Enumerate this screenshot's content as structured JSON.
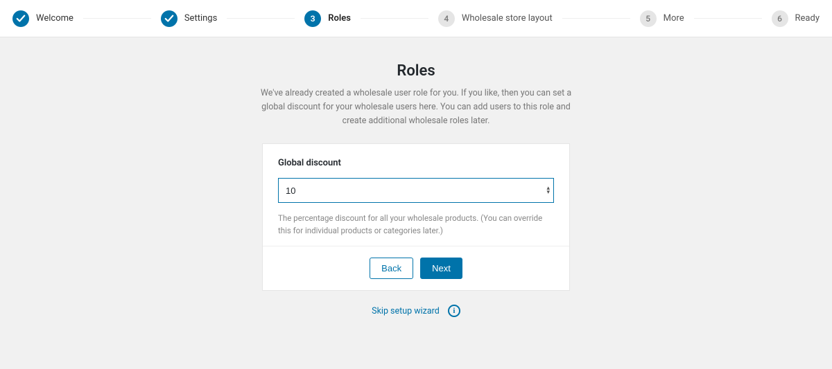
{
  "stepper": {
    "steps": [
      {
        "label": "Welcome",
        "state": "done",
        "number": "1"
      },
      {
        "label": "Settings",
        "state": "done",
        "number": "2"
      },
      {
        "label": "Roles",
        "state": "active",
        "number": "3"
      },
      {
        "label": "Wholesale store layout",
        "state": "pending",
        "number": "4"
      },
      {
        "label": "More",
        "state": "pending",
        "number": "5"
      },
      {
        "label": "Ready",
        "state": "pending",
        "number": "6"
      }
    ]
  },
  "page": {
    "title": "Roles",
    "description": "We've already created a wholesale user role for you. If you like, then you can set a global discount for your wholesale users here. You can add users to this role and create additional wholesale roles later."
  },
  "form": {
    "global_discount_label": "Global discount",
    "global_discount_value": "10",
    "global_discount_help": "The percentage discount for all your wholesale products. (You can override this for individual products or categories later.)"
  },
  "buttons": {
    "back": "Back",
    "next": "Next"
  },
  "footer": {
    "skip_label": "Skip setup wizard",
    "info_glyph": "i"
  }
}
